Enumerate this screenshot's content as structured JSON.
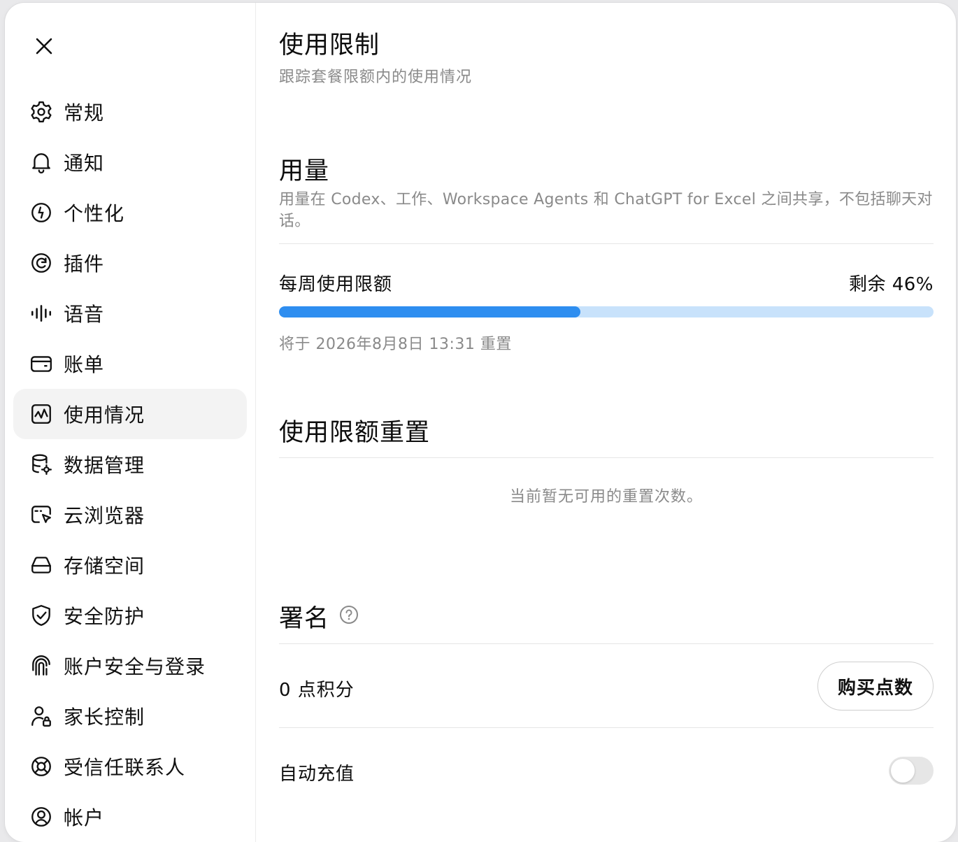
{
  "sidebar": {
    "items": [
      {
        "label": "常规",
        "icon": "gear-icon"
      },
      {
        "label": "通知",
        "icon": "bell-icon"
      },
      {
        "label": "个性化",
        "icon": "personalization-icon"
      },
      {
        "label": "插件",
        "icon": "plugin-icon"
      },
      {
        "label": "语音",
        "icon": "voice-waveform-icon"
      },
      {
        "label": "账单",
        "icon": "wallet-icon"
      },
      {
        "label": "使用情况",
        "icon": "usage-chart-icon",
        "active": true
      },
      {
        "label": "数据管理",
        "icon": "database-gear-icon"
      },
      {
        "label": "云浏览器",
        "icon": "cloud-browser-icon"
      },
      {
        "label": "存储空间",
        "icon": "storage-drive-icon"
      },
      {
        "label": "安全防护",
        "icon": "shield-check-icon"
      },
      {
        "label": "账户安全与登录",
        "icon": "security-login-icon"
      },
      {
        "label": "家长控制",
        "icon": "parental-control-icon"
      },
      {
        "label": "受信任联系人",
        "icon": "lifebuoy-icon"
      },
      {
        "label": "帐户",
        "icon": "account-circle-icon"
      }
    ]
  },
  "main": {
    "title": "使用限制",
    "subtitle": "跟踪套餐限额内的使用情况",
    "usage": {
      "title": "用量",
      "description": "用量在 Codex、工作、Workspace Agents 和 ChatGPT for Excel 之间共享，不包括聊天对话。",
      "weekly_label": "每周使用限额",
      "remaining_text": "剩余 46%",
      "used_fraction": 0.46,
      "reset_text": "将于 2026年8月8日 13:31 重置"
    },
    "limit_reset": {
      "title": "使用限额重置",
      "empty_text": "当前暂无可用的重置次数。"
    },
    "signature": {
      "title": "署名",
      "points_text": "0 点积分",
      "buy_button": "购买点数",
      "auto_topup_label": "自动充值",
      "auto_topup_enabled": false
    }
  },
  "colors": {
    "progress_fill": "#2e8ef0",
    "progress_track": "#c8e2fb",
    "active_nav_bg": "#f3f3f3"
  }
}
